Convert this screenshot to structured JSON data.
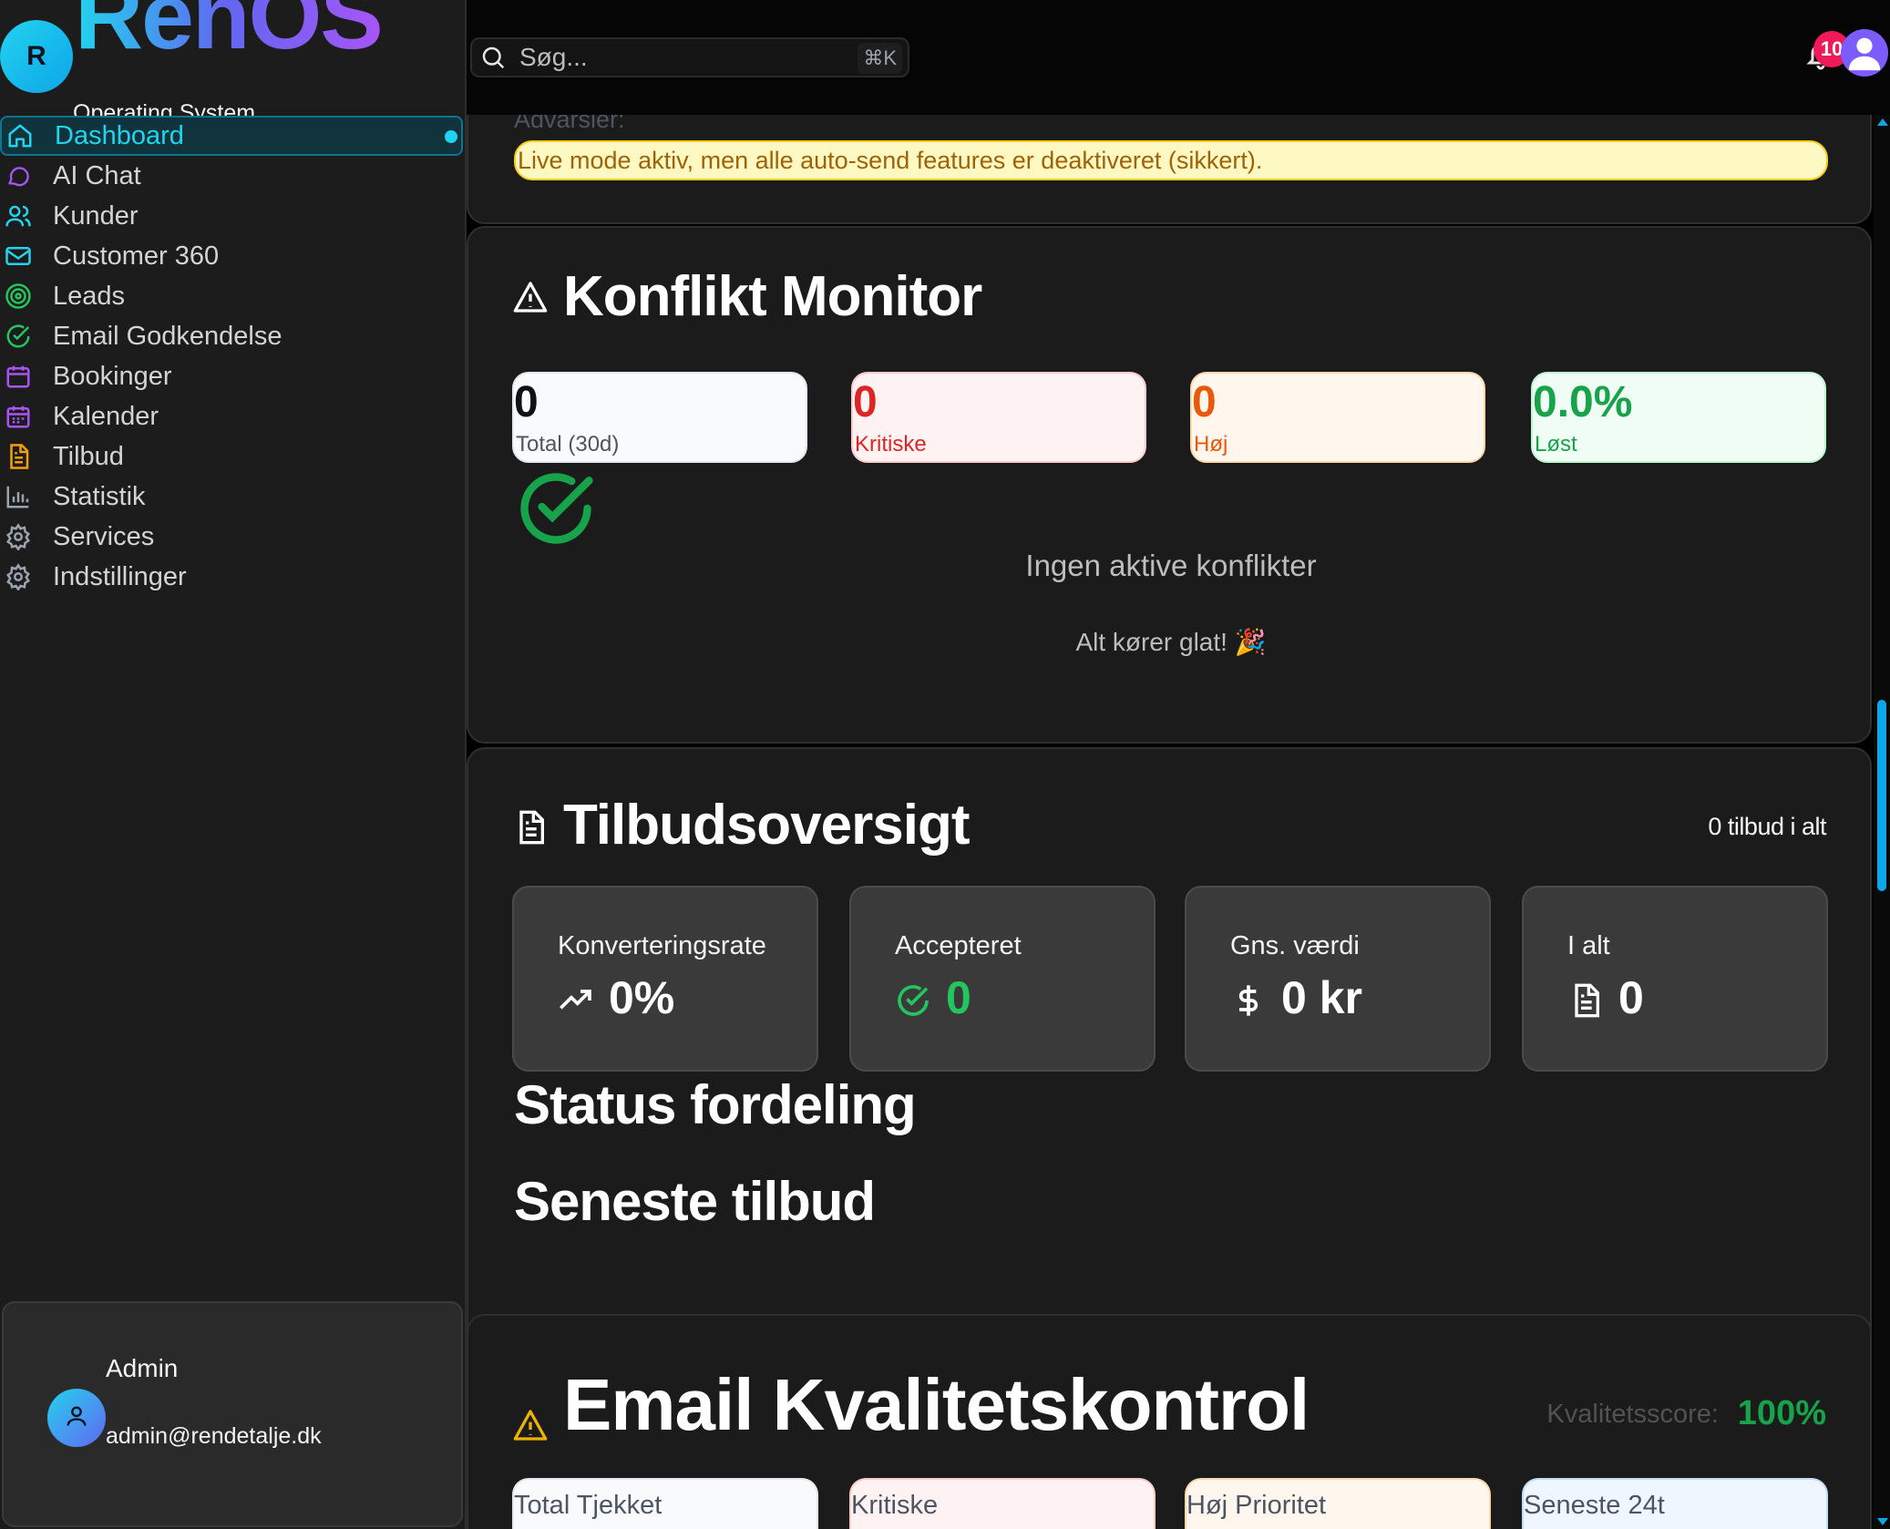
{
  "brand": {
    "initial": "R",
    "name": "RenOS",
    "subtitle": "Operating System"
  },
  "sidebar": {
    "items": [
      {
        "label": "Dashboard",
        "icon": "home-icon",
        "color": "#22d3ee",
        "active": true
      },
      {
        "label": "AI Chat",
        "icon": "chat-bubble-icon",
        "color": "#a855f7"
      },
      {
        "label": "Kunder",
        "icon": "users-icon",
        "color": "#22d3ee"
      },
      {
        "label": "Customer 360",
        "icon": "mail-icon",
        "color": "#22d3ee"
      },
      {
        "label": "Leads",
        "icon": "target-icon",
        "color": "#22c55e"
      },
      {
        "label": "Email Godkendelse",
        "icon": "check-circle-icon",
        "color": "#22c55e"
      },
      {
        "label": "Bookinger",
        "icon": "calendar-icon",
        "color": "#a855f7"
      },
      {
        "label": "Kalender",
        "icon": "calendar-days-icon",
        "color": "#a855f7"
      },
      {
        "label": "Tilbud",
        "icon": "document-icon",
        "color": "#f59e0b"
      },
      {
        "label": "Statistik",
        "icon": "bar-chart-icon",
        "color": "#9ca3af"
      },
      {
        "label": "Services",
        "icon": "gear-icon",
        "color": "#9ca3af"
      },
      {
        "label": "Indstillinger",
        "icon": "gear-icon",
        "color": "#9ca3af"
      }
    ]
  },
  "user": {
    "name": "Admin",
    "email": "admin@rendetalje.dk",
    "icon": "user-icon"
  },
  "topbar": {
    "search_placeholder": "Søg...",
    "shortcut": "⌘K",
    "notifications": "10"
  },
  "warnings": {
    "heading": "Advarsler:",
    "message": "Live mode aktiv, men alle auto-send features er deaktiveret (sikkert)."
  },
  "conflict": {
    "title": "Konflikt Monitor",
    "icon": "warning-triangle-icon",
    "stats": [
      {
        "value": "0",
        "caption": "Total (30d)",
        "color": "#111111",
        "bg": "#f8fafc",
        "border": "#e5e7eb",
        "capcolor": "#4b5563"
      },
      {
        "value": "0",
        "caption": "Kritiske",
        "color": "#dc2626",
        "bg": "#fef2f2",
        "border": "#fecaca",
        "capcolor": "#dc2626"
      },
      {
        "value": "0",
        "caption": "Høj",
        "color": "#ea580c",
        "bg": "#fff7ed",
        "border": "#fed7aa",
        "capcolor": "#ea580c"
      },
      {
        "value": "0.0%",
        "caption": "Løst",
        "color": "#16a34a",
        "bg": "#f0fdf4",
        "border": "#bbf7d0",
        "capcolor": "#16a34a"
      }
    ],
    "empty_title": "Ingen aktive konflikter",
    "empty_sub": "Alt kører glat! 🎉"
  },
  "offers": {
    "title": "Tilbudsoversigt",
    "count_text": "0 tilbud i alt",
    "cards": [
      {
        "label": "Konverteringsrate",
        "value": "0%",
        "icon": "trending-up-icon",
        "color": "#ffffff"
      },
      {
        "label": "Accepteret",
        "value": "0",
        "icon": "check-circle-icon",
        "color": "#22c55e"
      },
      {
        "label": "Gns. værdi",
        "value": "0 kr",
        "icon": "dollar-icon",
        "color": "#ffffff"
      },
      {
        "label": "I alt",
        "value": "0",
        "icon": "document-icon",
        "color": "#ffffff"
      }
    ],
    "status_heading": "Status fordeling",
    "latest_heading": "Seneste tilbud"
  },
  "quality": {
    "title": "Email Kvalitetskontrol",
    "score_label": "Kvalitetsscore:",
    "score_value": "100%",
    "stats": [
      {
        "caption": "Total Tjekket",
        "bg": "#f8fafc",
        "border": "#e5e7eb",
        "capcolor": "#4b5563",
        "dot": ""
      },
      {
        "caption": "Kritiske",
        "bg": "#fef2f2",
        "border": "#fecaca",
        "capcolor": "#4b5563",
        "dot": "#dc2626"
      },
      {
        "caption": "Høj Prioritet",
        "bg": "#fff7ed",
        "border": "#fed7aa",
        "capcolor": "#4b5563",
        "dot": "#ea580c"
      },
      {
        "caption": "Seneste 24t",
        "bg": "#eff6ff",
        "border": "#bfdbfe",
        "capcolor": "#4b5563",
        "dot": "#2563eb"
      }
    ]
  }
}
